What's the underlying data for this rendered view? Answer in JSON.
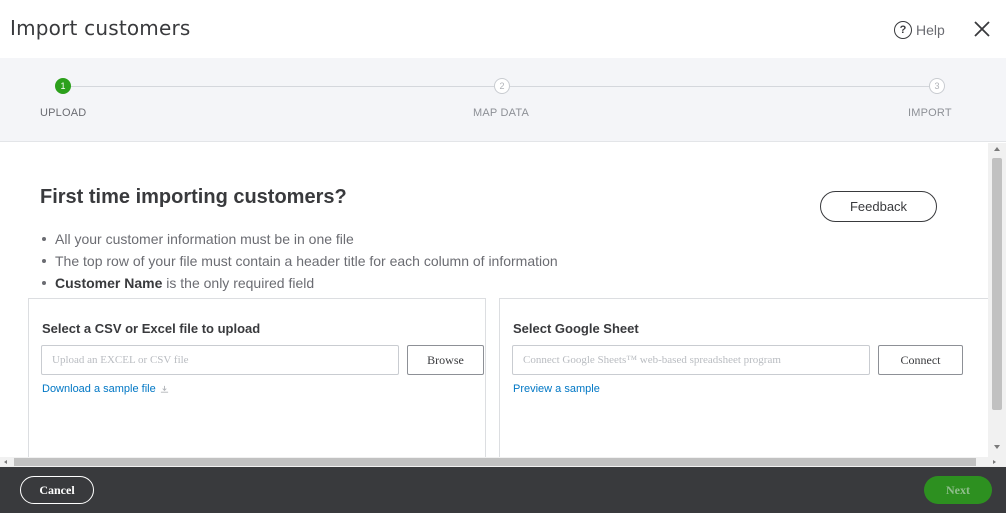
{
  "dialog": {
    "title": "Import customers",
    "help_label": "Help",
    "help_icon_glyph": "?"
  },
  "stepper": {
    "steps": [
      {
        "number": "1",
        "label": "UPLOAD",
        "state": "active"
      },
      {
        "number": "2",
        "label": "MAP DATA",
        "state": "inactive"
      },
      {
        "number": "3",
        "label": "IMPORT",
        "state": "inactive"
      }
    ]
  },
  "intro": {
    "heading": "First time importing customers?",
    "feedback_label": "Feedback",
    "bullets": [
      "All your customer information must be in one file",
      "The top row of your file must contain a header title for each column of information"
    ],
    "bullet3_bold": "Customer Name",
    "bullet3_rest": " is the only required field"
  },
  "upload": {
    "title": "Select a CSV or Excel file to upload",
    "placeholder": "Upload an EXCEL or CSV file",
    "browse_label": "Browse",
    "sample_link": "Download a sample file"
  },
  "google": {
    "title": "Select Google Sheet",
    "placeholder": "Connect Google Sheets™ web-based spreadsheet program",
    "connect_label": "Connect",
    "sample_link": "Preview a sample"
  },
  "footer": {
    "cancel_label": "Cancel",
    "next_label": "Next"
  },
  "colors": {
    "accent_green": "#2ca01c",
    "link_blue": "#0077c5",
    "footer_bg": "#393a3d"
  }
}
